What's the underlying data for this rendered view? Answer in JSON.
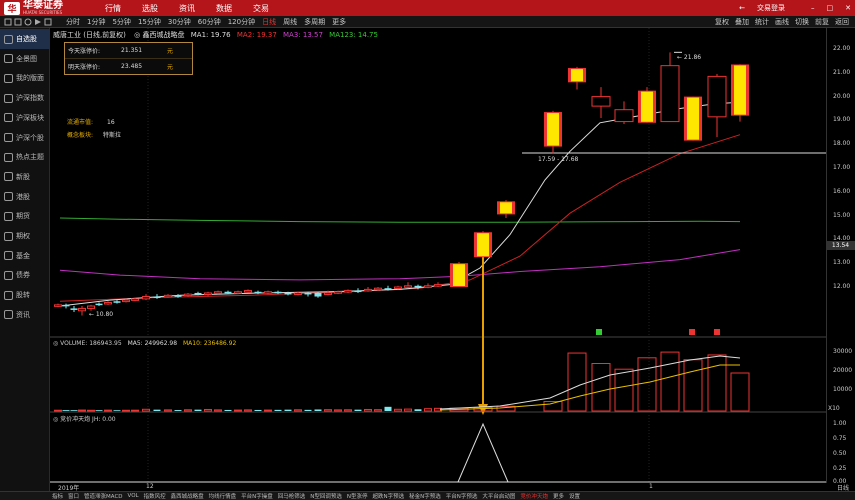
{
  "brand": {
    "name": "华泰证券",
    "sub": "HUATAI SECURITIES",
    "logo": "华"
  },
  "nav": [
    "行情",
    "选股",
    "资讯",
    "数据",
    "交易"
  ],
  "top_right": {
    "back": "←",
    "login": "交易登录",
    "minimize": "–",
    "maximize": "□",
    "close": "✕"
  },
  "periods": [
    "分时",
    "1分钟",
    "5分钟",
    "15分钟",
    "30分钟",
    "60分钟",
    "120分钟",
    "日线",
    "周线",
    "多周期",
    "更多"
  ],
  "active_period": "日线",
  "tools": [
    "复权",
    "叠加",
    "统计",
    "画线",
    "切换",
    "前复",
    "返回"
  ],
  "sidebar": [
    "自选股",
    "全景图",
    "我的版面",
    "沪深指数",
    "沪深板块",
    "沪深个股",
    "热点主题",
    "新股",
    "港股",
    "期货",
    "期权",
    "基金",
    "债券",
    "股转",
    "资讯"
  ],
  "header": {
    "stock": "威唐工业 (日线,前复权)",
    "indicator": "◎ 鑫西城战略盘",
    "ma1": "MA1: 19.76",
    "ma2": "MA2: 19.37",
    "ma3": "MA3: 13.57",
    "ma123": "MA123: 14.75"
  },
  "limit_box": {
    "today_label": "今天涨停价:",
    "today_value": "21.351",
    "today_unit": "元",
    "tomorrow_label": "明天涨停价:",
    "tomorrow_value": "23.485",
    "tomorrow_unit": "元"
  },
  "sector": {
    "circ_label": "流通市值:",
    "circ_value": "16",
    "concept_label": "概念板块:",
    "concept_value": "特斯拉"
  },
  "annotations": {
    "range": "17.59 - 17.68",
    "high": "← 21.86",
    "low": "← 10.80"
  },
  "volume_header": {
    "volume": "◎ VOLUME: 186943.95",
    "ma5": "MA5: 249962.98",
    "ma10": "MA10: 236486.92"
  },
  "indicator_header": "◎ 竞价冲天炮 JH: 0.00",
  "y_price": [
    "22.00",
    "21.00",
    "20.00",
    "19.00",
    "18.00",
    "17.00",
    "16.00",
    "15.00",
    "14.00",
    "13.00",
    "12.00"
  ],
  "current_price": "13.54",
  "y_volume": [
    "30000",
    "20000",
    "10000"
  ],
  "volume_unit": "X10",
  "y_indicator": [
    "1.00",
    "0.75",
    "0.50",
    "0.25",
    "0.00"
  ],
  "dates": [
    "2019年",
    "12",
    "1"
  ],
  "period_label": "日线",
  "indicator_bar": [
    "指标",
    "窗口",
    "管道滞涨MACD",
    "VOL",
    "指数风控",
    "鑫西城战略盘",
    "均线行情盘",
    "平台N字操盘",
    "回马枪筛选",
    "N型回调预选",
    "N型涨停",
    "超跌N字预选",
    "秘金N字预选",
    "平台N字预选",
    "大平台启动图",
    "竞价冲天炮",
    "更多",
    "设置"
  ],
  "active_indicator": "竞价冲天炮",
  "colors": {
    "brand_red": "#b3151b",
    "up": "#e33",
    "down": "#7fe8ee",
    "limit_up_fill": "#ffe600",
    "ma_white": "#ddd",
    "ma_red": "#c22",
    "ma_purple": "#c030c0",
    "ma_green": "#3a3"
  }
}
